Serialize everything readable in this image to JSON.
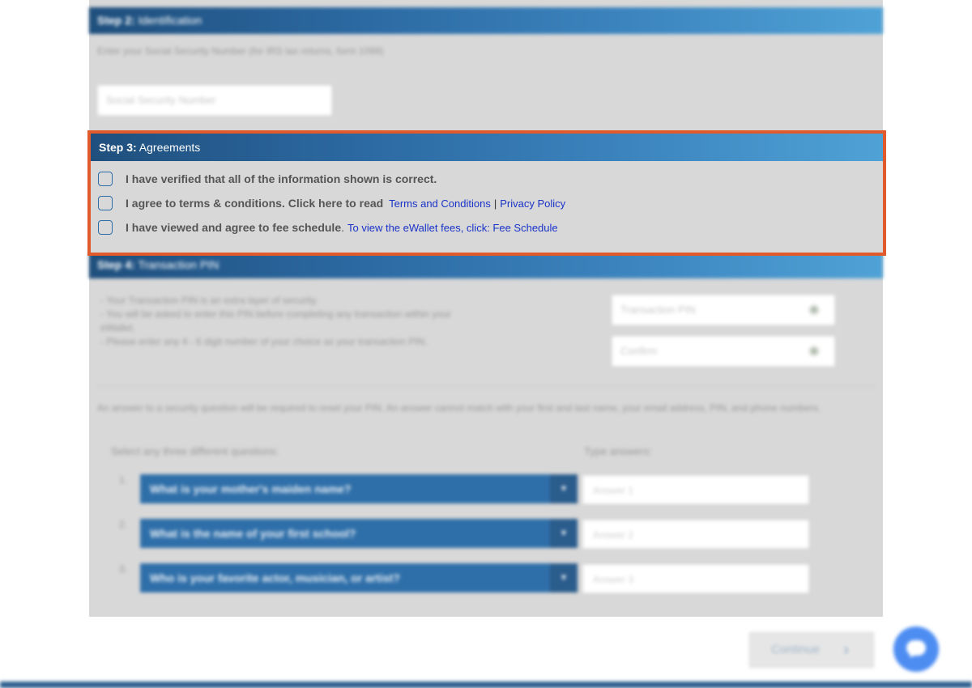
{
  "step2": {
    "title_bold": "Step 2:",
    "title": " Identification",
    "description": "Enter your Social Security Number (for IRS tax returns, form 1099)",
    "ssn_placeholder": "Social Security Number"
  },
  "step3": {
    "title_bold": "Step 3:",
    "title": " Agreements",
    "items": [
      {
        "text": "I have verified that all of the information shown is correct."
      },
      {
        "text": "I agree to terms & conditions. Click here to read ",
        "link1": "Terms and Conditions",
        "separator": "|",
        "link2": "Privacy Policy"
      },
      {
        "text": "I have viewed and agree to fee schedule",
        "suffix": ".",
        "link": "To view the eWallet fees, click: Fee Schedule"
      }
    ]
  },
  "step4": {
    "title_bold": "Step 4:",
    "title": " Transaction PIN",
    "bullets": [
      "- Your Transaction PIN is an extra layer of security.",
      "- You will be asked to enter this PIN before completing any transaction within your",
      "  eWallet.",
      "- Please enter any 4 - 6 digit number of your choice as your transaction PIN."
    ],
    "pin_placeholder": "Transaction PIN",
    "confirm_placeholder": "Confirm",
    "security_note": "An answer to a security question will be required to reset your PIN. An answer cannot match with your first and last name, your email address, PIN, and phone numbers.",
    "questions_heading": "Select any three different questions:",
    "answers_heading": "Type answers:",
    "questions": [
      {
        "num": "1.",
        "question": "What is your mother's maiden name?",
        "answer_placeholder": "Answer 1"
      },
      {
        "num": "2.",
        "question": "What is the name of your first school?",
        "answer_placeholder": "Answer 2"
      },
      {
        "num": "3.",
        "question": "Who is your favorite actor, musician, or artist?",
        "answer_placeholder": "Answer 3"
      }
    ]
  },
  "actions": {
    "continue_label": "Continue",
    "continue_icon": "chevron-right-icon",
    "chat_icon": "chat-bubble-icon"
  },
  "colors": {
    "header_gradient_start": "#1f4f7d",
    "header_gradient_end": "#4fa2d6",
    "highlight_border": "#e05a2b",
    "link": "#1a33c8",
    "chat_button": "#4d8df2"
  }
}
